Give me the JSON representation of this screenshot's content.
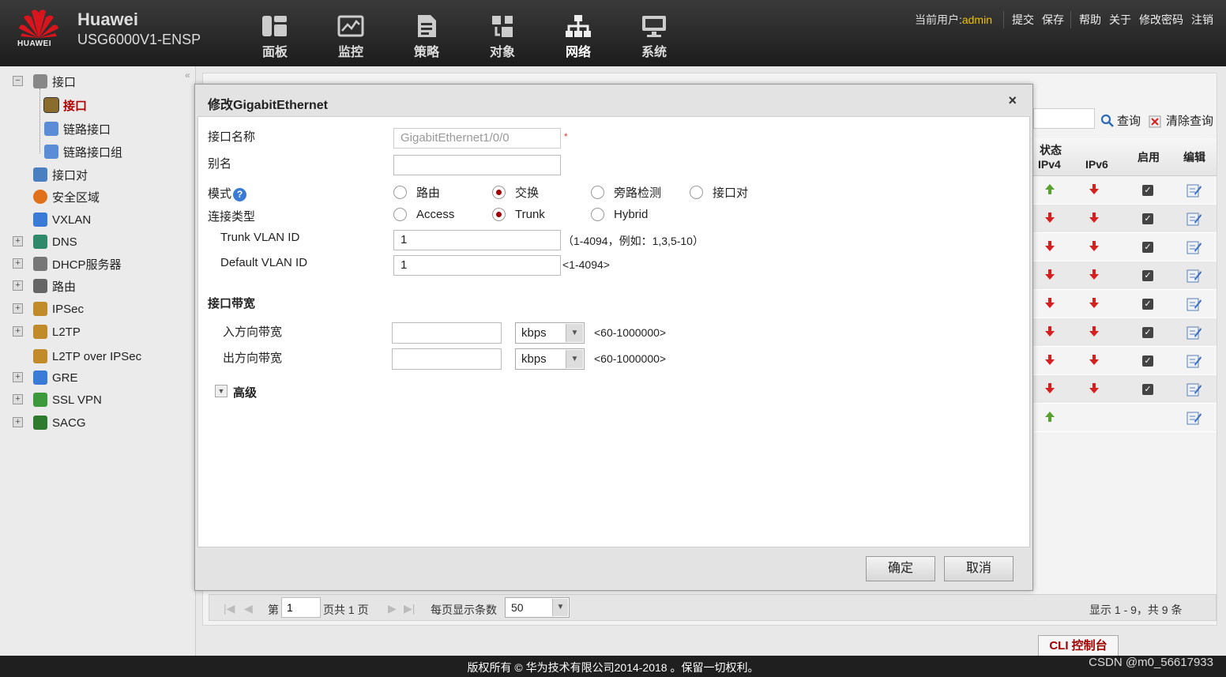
{
  "header": {
    "brand": "Huawei",
    "model": "USG6000V1-ENSP",
    "logo_text": "HUAWEI",
    "nav": [
      {
        "label": "面板",
        "icon": "dashboard-icon"
      },
      {
        "label": "监控",
        "icon": "monitor-icon"
      },
      {
        "label": "策略",
        "icon": "policy-icon"
      },
      {
        "label": "对象",
        "icon": "object-icon"
      },
      {
        "label": "网络",
        "icon": "network-icon"
      },
      {
        "label": "系统",
        "icon": "system-icon"
      }
    ],
    "current_user_label": "当前用户:",
    "current_user": "admin",
    "links": [
      "提交",
      "保存",
      "帮助",
      "关于",
      "修改密码",
      "注销"
    ]
  },
  "sidebar": {
    "items": [
      {
        "label": "接口",
        "expander": "−"
      },
      {
        "label": "接口",
        "selected": true
      },
      {
        "label": "链路接口"
      },
      {
        "label": "链路接口组"
      },
      {
        "label": "接口对"
      },
      {
        "label": "安全区域"
      },
      {
        "label": "VXLAN"
      },
      {
        "label": "DNS",
        "expander": "+"
      },
      {
        "label": "DHCP服务器",
        "expander": "+"
      },
      {
        "label": "路由",
        "expander": "+"
      },
      {
        "label": "IPSec",
        "expander": "+"
      },
      {
        "label": "L2TP",
        "expander": "+"
      },
      {
        "label": "L2TP over IPSec"
      },
      {
        "label": "GRE",
        "expander": "+"
      },
      {
        "label": "SSL VPN",
        "expander": "+"
      },
      {
        "label": "SACG",
        "expander": "+"
      }
    ]
  },
  "background": {
    "search_label": "查询",
    "clear_label": "清除查询",
    "columns": {
      "status": "状态",
      "ipv4": "IPv4",
      "ipv6": "IPv6",
      "enable": "启用",
      "edit": "编辑"
    },
    "rows": [
      {
        "ipv4": "up",
        "ipv6": "down",
        "enabled": true
      },
      {
        "ipv4": "down",
        "ipv6": "down",
        "enabled": true
      },
      {
        "ipv4": "down",
        "ipv6": "down",
        "enabled": true
      },
      {
        "ipv4": "down",
        "ipv6": "down",
        "enabled": true
      },
      {
        "ipv4": "down",
        "ipv6": "down",
        "enabled": true
      },
      {
        "ipv4": "down",
        "ipv6": "down",
        "enabled": true
      },
      {
        "ipv4": "down",
        "ipv6": "down",
        "enabled": true
      },
      {
        "ipv4": "down",
        "ipv6": "down",
        "enabled": true
      },
      {
        "ipv4": "up",
        "ipv6": "",
        "enabled": false
      }
    ],
    "pager": {
      "page_prefix": "第",
      "page_value": "1",
      "page_suffix": "页共 1 页",
      "per_page_label": "每页显示条数",
      "per_page_value": "50",
      "summary": "显示 1 - 9，共 9 条"
    },
    "cli_label": "CLI 控制台"
  },
  "modal": {
    "title": "修改GigabitEthernet",
    "close": "×",
    "name_label": "接口名称",
    "name_value": "GigabitEthernet1/0/0",
    "required_mark": "*",
    "alias_label": "别名",
    "alias_value": "",
    "mode_label": "模式",
    "help": "?",
    "modes": [
      "路由",
      "交换",
      "旁路检测",
      "接口对"
    ],
    "mode_selected": 1,
    "link_type_label": "连接类型",
    "link_types": [
      "Access",
      "Trunk",
      "Hybrid"
    ],
    "link_type_selected": 1,
    "trunk_vlan_label": "Trunk VLAN ID",
    "trunk_vlan_value": "1",
    "trunk_vlan_hint": "（1-4094，例如：1,3,5-10）",
    "default_vlan_label": "Default VLAN ID",
    "default_vlan_value": "1",
    "default_vlan_hint": "<1-4094>",
    "bandwidth_section": "接口带宽",
    "in_bw_label": "入方向带宽",
    "out_bw_label": "出方向带宽",
    "bw_unit": "kbps",
    "bw_hint": "<60-1000000>",
    "advanced_label": "高级",
    "ok_label": "确定",
    "cancel_label": "取消"
  },
  "footer": {
    "copyright": "版权所有 © 华为技术有限公司2014-2018 。保留一切权利。",
    "watermark": "CSDN @m0_56617933"
  },
  "colors": {
    "user": "#f0c000",
    "selected": "#b00000",
    "up": "#5aa02c",
    "down": "#d62020"
  }
}
